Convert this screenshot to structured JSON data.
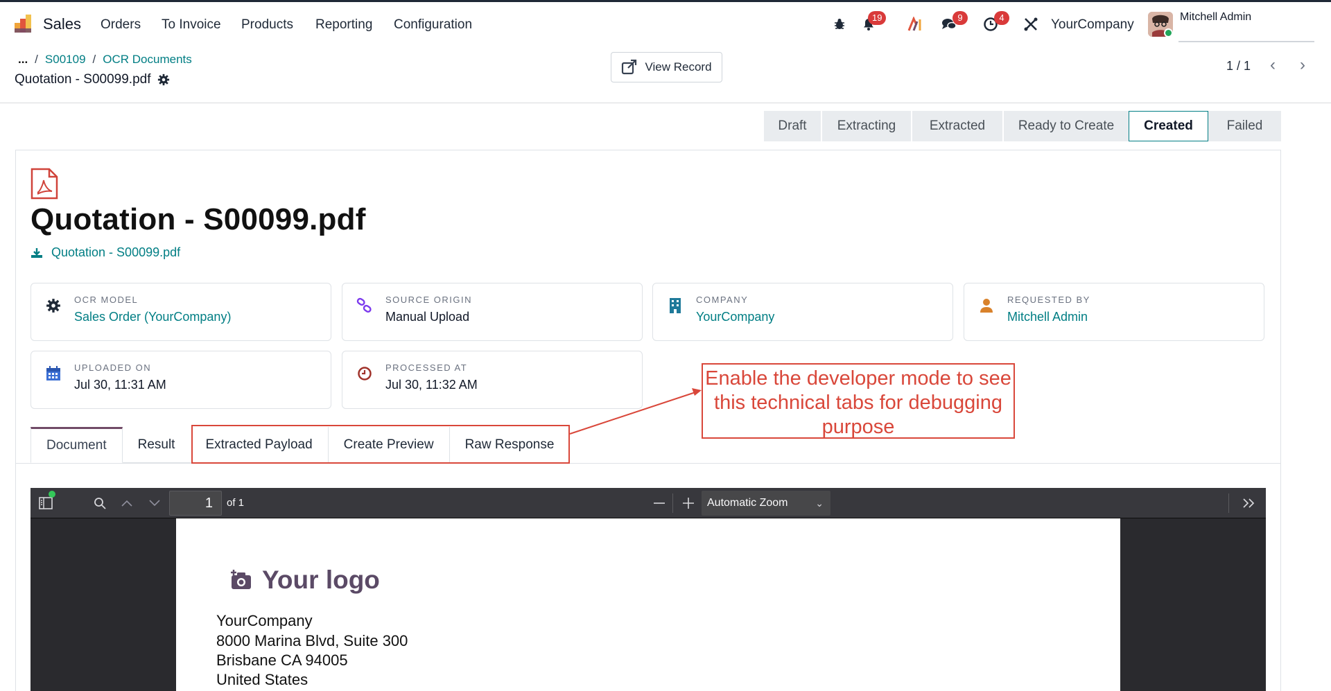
{
  "navbar": {
    "app_name": "Sales",
    "menu": [
      "Orders",
      "To Invoice",
      "Products",
      "Reporting",
      "Configuration"
    ],
    "badges": {
      "notifications": "19",
      "messages": "9",
      "activities": "4"
    },
    "company": "YourCompany",
    "user": "Mitchell Admin"
  },
  "control_panel": {
    "breadcrumb": [
      "...",
      "S00109",
      "OCR Documents"
    ],
    "record_title": "Quotation - S00099.pdf",
    "view_record_label": "View Record",
    "pager": "1 / 1"
  },
  "status_stages": [
    "Draft",
    "Extracting",
    "Extracted",
    "Ready to Create",
    "Created",
    "Failed"
  ],
  "active_stage": "Created",
  "document": {
    "title": "Quotation - S00099.pdf",
    "download_label": "Quotation - S00099.pdf"
  },
  "cards": [
    {
      "label": "OCR MODEL",
      "value": "Sales Order (YourCompany)",
      "icon": "gear-icon"
    },
    {
      "label": "SOURCE ORIGIN",
      "value": "Manual Upload",
      "icon": "link-icon"
    },
    {
      "label": "COMPANY",
      "value": "YourCompany",
      "icon": "building-icon"
    },
    {
      "label": "REQUESTED BY",
      "value": "Mitchell Admin",
      "icon": "user-icon"
    },
    {
      "label": "UPLOADED ON",
      "value": "Jul 30, 11:31 AM",
      "icon": "calendar-icon"
    },
    {
      "label": "PROCESSED AT",
      "value": "Jul 30, 11:32 AM",
      "icon": "clock-icon"
    }
  ],
  "annotation": {
    "line1": "Enable the developer mode to see",
    "line2": "this technical tabs for debugging",
    "line3": "purpose",
    "color": "#d9473a"
  },
  "tabs": [
    "Document",
    "Result",
    "Extracted Payload",
    "Create Preview",
    "Raw Response"
  ],
  "pdf_viewer": {
    "page_number": "1",
    "page_of": "of 1",
    "zoom": "Automatic Zoom",
    "logo_text": "Your logo",
    "address": [
      "YourCompany",
      "8000 Marina Blvd, Suite 300",
      "Brisbane CA 94005",
      "United States"
    ]
  },
  "colors": {
    "accent": "#017e84",
    "brand": "#714b67",
    "badge": "#d93a3a"
  }
}
